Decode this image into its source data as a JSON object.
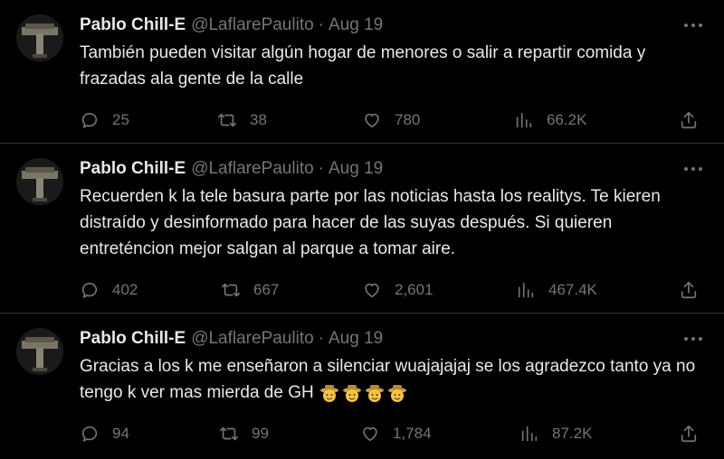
{
  "tweets": [
    {
      "name": "Pablo Chill-E",
      "handle": "@LaflarePaulito",
      "dot": "·",
      "date": "Aug 19",
      "text": "También pueden visitar algún hogar de menores o salir a repartir comida y frazadas ala gente de la calle",
      "replies": "25",
      "retweets": "38",
      "likes": "780",
      "views": "66.2K"
    },
    {
      "name": "Pablo Chill-E",
      "handle": "@LaflarePaulito",
      "dot": "·",
      "date": "Aug 19",
      "text": "Recuerden k la tele basura parte por las noticias hasta los realitys. Te kieren distraído y desinformado para hacer de las suyas después. Si quieren entreténcion mejor salgan al parque a tomar aire.",
      "replies": "402",
      "retweets": "667",
      "likes": "2,601",
      "views": "467.4K"
    },
    {
      "name": "Pablo Chill-E",
      "handle": "@LaflarePaulito",
      "dot": "·",
      "date": "Aug 19",
      "text": "Gracias a los k me enseñaron a silenciar wuajajajaj se los agradezco tanto ya no tengo k ver mas mierda de GH",
      "emojis": [
        "cowboy-face-emoji",
        "cowboy-face-emoji",
        "cowboy-face-emoji",
        "cowboy-face-emoji"
      ],
      "replies": "94",
      "retweets": "99",
      "likes": "1,784",
      "views": "87.2K"
    }
  ],
  "colors": {
    "background": "#000000",
    "text": "#e7e9ea",
    "muted": "#71767b",
    "divider": "#2f3336"
  }
}
